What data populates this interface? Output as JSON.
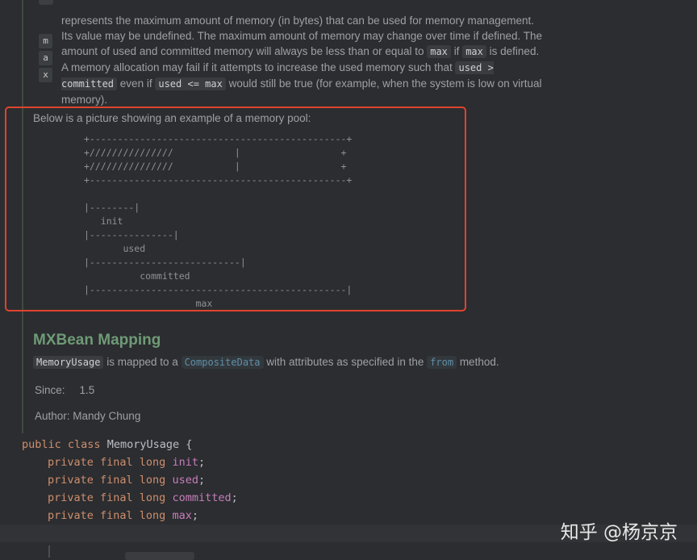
{
  "doc": {
    "gutter_letters": [
      "m",
      "a",
      "x"
    ],
    "max_paragraph": {
      "t1": "represents the maximum amount of memory (in bytes) that can be used for memory management. Its value may be undefined. The maximum amount of memory may change over time if defined. The amount of used and committed memory will always be less than or equal to",
      "c1": "max",
      "t2": "if",
      "c2": "max",
      "t3": "is defined. A memory allocation may fail if it attempts to increase the used memory such that",
      "c3": "used > committed",
      "t4": "even if",
      "c4": "used <= max",
      "t5": "would still be true (for example, when the system is low on virtual memory)."
    },
    "pool_intro": "Below is a picture showing an example of a memory pool:",
    "ascii_art": "+----------------------------------------------+\n+///////////////           |                  +\n+///////////////           |                  +\n+----------------------------------------------+\n\n|--------|\n   init\n|---------------|\n       used\n|---------------------------|\n          committed\n|----------------------------------------------|\n                    max",
    "heading": "MXBean Mapping",
    "mapping": {
      "c1": "MemoryUsage",
      "t1": "is mapped to a",
      "l1": "CompositeData",
      "t2": "with attributes as specified in the",
      "l2": "from",
      "t3": "method."
    },
    "since_label": "Since:",
    "since_value": "1.5",
    "author": "Author: Mandy Chung"
  },
  "code": {
    "line1": {
      "kw": "public class",
      "cls": "MemoryUsage",
      "pun": "{"
    },
    "fields": [
      {
        "mods": "private final long",
        "name": "init"
      },
      {
        "mods": "private final long",
        "name": "used"
      },
      {
        "mods": "private final long",
        "name": "committed"
      },
      {
        "mods": "private final long",
        "name": "max"
      }
    ]
  },
  "watermark": "知乎 @杨京京"
}
